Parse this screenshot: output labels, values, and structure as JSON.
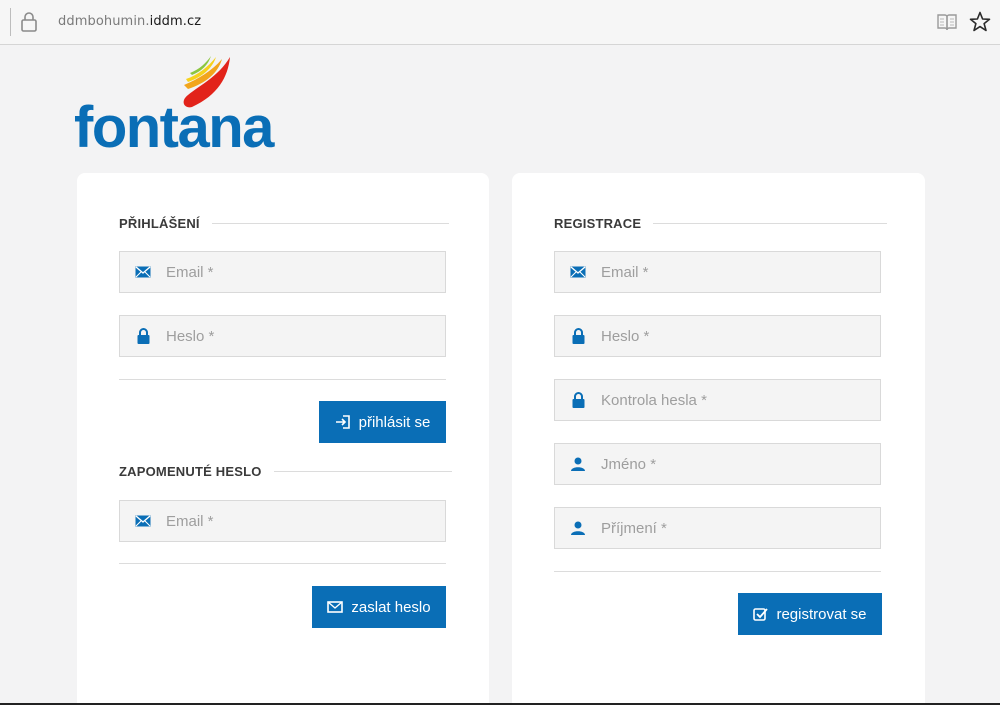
{
  "browser": {
    "url_prefix": "ddmbohumin.",
    "url_domain": "iddm.cz"
  },
  "logo": {
    "text": "fontana"
  },
  "login": {
    "title": "PŘIHLÁŠENÍ",
    "email_placeholder": "Email *",
    "password_placeholder": "Heslo *",
    "submit_label": "přihlásit se"
  },
  "forgot": {
    "title": "ZAPOMENUTÉ HESLO",
    "email_placeholder": "Email *",
    "submit_label": "zaslat heslo"
  },
  "register": {
    "title": "REGISTRACE",
    "email_placeholder": "Email *",
    "password_placeholder": "Heslo *",
    "password_check_placeholder": "Kontrola hesla *",
    "first_name_placeholder": "Jméno *",
    "last_name_placeholder": "Příjmení *",
    "submit_label": "registrovat se"
  },
  "colors": {
    "accent": "#0a6eb6",
    "background": "#f3f3f4",
    "card": "#ffffff"
  },
  "icons": [
    "lock-icon",
    "reader-view-icon",
    "favorite-star-icon",
    "envelope-icon",
    "padlock-icon",
    "user-icon",
    "sign-in-icon",
    "check-square-icon"
  ]
}
